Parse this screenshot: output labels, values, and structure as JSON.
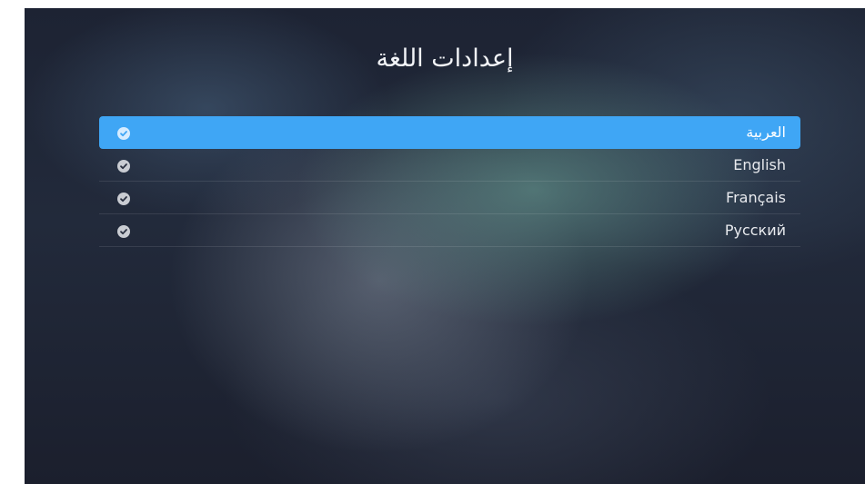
{
  "page": {
    "title": "إعدادات اللغة"
  },
  "languages": [
    {
      "label": "العربية",
      "selected": true,
      "icon": "check-circle-icon"
    },
    {
      "label": "English",
      "selected": false,
      "icon": "check-circle-icon"
    },
    {
      "label": "Français",
      "selected": false,
      "icon": "check-circle-icon"
    },
    {
      "label": "Русский",
      "selected": false,
      "icon": "check-circle-icon"
    }
  ],
  "colors": {
    "selection": "#3fa6f5",
    "background": "#1d2333",
    "text": "#e8eaee"
  }
}
